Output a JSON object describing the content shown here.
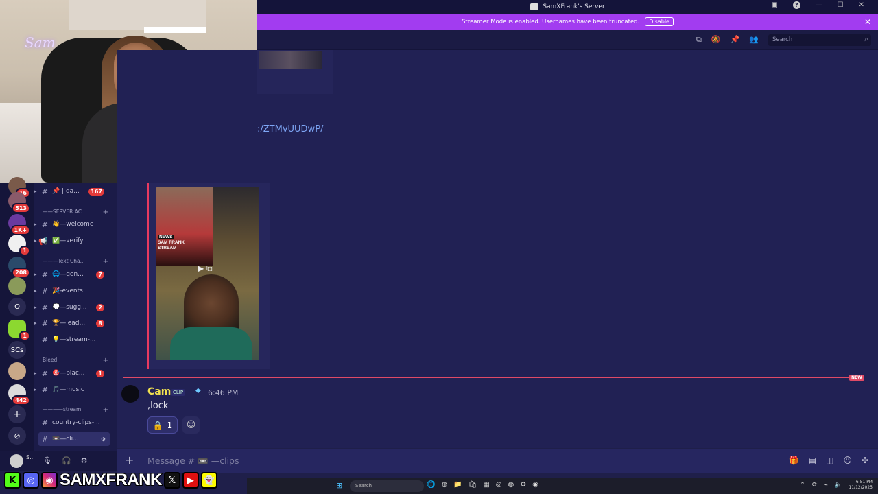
{
  "titlebar": {
    "title": "SamXFrank's Server"
  },
  "streamer": {
    "message": "Streamer Mode is enabled. Usernames have been truncated.",
    "disable_label": "Disable"
  },
  "search": {
    "placeholder": "Search"
  },
  "chat": {
    "link_text": ":/ZTMvUUDwP/",
    "video": {
      "badge": "NEWS",
      "line1": "SAM FRANK",
      "line2": "STREAM"
    },
    "new_badge": "NEW",
    "message": {
      "author": "Cam",
      "tag": "CLIP",
      "time": "6:46 PM",
      "text": ",lock",
      "reaction_count": "1"
    }
  },
  "composer": {
    "placeholder": "Message # 📼 —clips"
  },
  "servers": [
    {
      "badge": "16"
    },
    {
      "badge": "513"
    },
    {
      "badge": "1K+"
    },
    {
      "badge": "1"
    },
    {
      "badge": "208"
    },
    {
      "badge": ""
    },
    {
      "label": "O"
    },
    {
      "badge": "1"
    },
    {
      "label": "SCs"
    },
    {
      "badge": ""
    },
    {
      "badge": "442"
    }
  ],
  "channels": {
    "items": [
      {
        "name": "📌 | da...",
        "badge": "167"
      },
      {
        "name": "👋—welcome",
        "badge": ""
      },
      {
        "name": "✅—verify",
        "badge": ""
      },
      {
        "name": "🌐—gen...",
        "badge": "7"
      },
      {
        "name": "🎉-events",
        "badge": ""
      },
      {
        "name": "💭—sugg...",
        "badge": "2"
      },
      {
        "name": "🏆—lead...",
        "badge": "8"
      },
      {
        "name": "💡—stream-...",
        "badge": ""
      },
      {
        "name": "🎯—blac...",
        "badge": "1"
      },
      {
        "name": "🎵—music",
        "badge": ""
      },
      {
        "name": "country-clips-...",
        "badge": ""
      },
      {
        "name": "📼—cli...",
        "badge": ""
      }
    ],
    "categories": [
      "——SERVER AC...",
      "———Text Cha...",
      "Bleed",
      "————stream"
    ]
  },
  "user": {
    "name": "S..."
  },
  "overlay": {
    "name": "SAMXFRANK"
  },
  "taskbar": {
    "search": "Search",
    "time": "6:51 PM",
    "date": "11/12/2025"
  },
  "webcam": {
    "neon": "Sam"
  },
  "colors": {
    "accent": "#a23cf0",
    "bg": "#1f1f4a",
    "badge": "#e33a3a",
    "name": "#f0e050"
  }
}
